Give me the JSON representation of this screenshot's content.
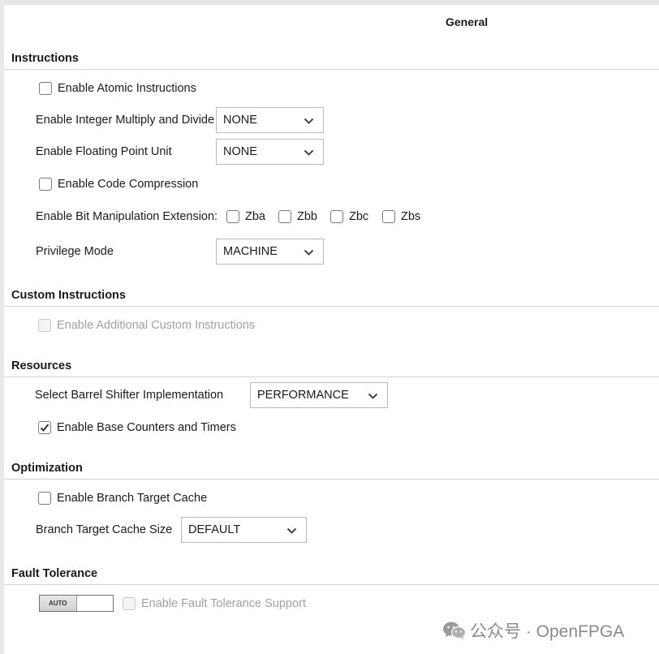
{
  "page": {
    "title": "General"
  },
  "sections": {
    "instructions": {
      "title": "Instructions",
      "atomic": {
        "label": "Enable Atomic Instructions",
        "checked": false
      },
      "mul_div": {
        "label": "Enable Integer Multiply and Divide",
        "value": "NONE"
      },
      "fpu": {
        "label": "Enable Floating Point Unit",
        "value": "NONE"
      },
      "compression": {
        "label": "Enable Code Compression",
        "checked": false
      },
      "bitmanip": {
        "label": "Enable Bit Manipulation Extension:",
        "options": [
          {
            "label": "Zba",
            "checked": false
          },
          {
            "label": "Zbb",
            "checked": false
          },
          {
            "label": "Zbc",
            "checked": false
          },
          {
            "label": "Zbs",
            "checked": false
          }
        ]
      },
      "privilege": {
        "label": "Privilege Mode",
        "value": "MACHINE"
      }
    },
    "custom": {
      "title": "Custom Instructions",
      "additional": {
        "label": "Enable Additional Custom Instructions",
        "checked": false,
        "enabled": false
      }
    },
    "resources": {
      "title": "Resources",
      "barrel": {
        "label": "Select Barrel Shifter Implementation",
        "value": "PERFORMANCE"
      },
      "counters": {
        "label": "Enable Base Counters and Timers",
        "checked": true
      }
    },
    "optimization": {
      "title": "Optimization",
      "btc": {
        "label": "Enable Branch Target Cache",
        "checked": false
      },
      "btc_size": {
        "label": "Branch Target Cache Size",
        "value": "DEFAULT"
      }
    },
    "fault": {
      "title": "Fault Tolerance",
      "toggle_label": "AUTO",
      "support": {
        "label": "Enable Fault Tolerance Support",
        "checked": false,
        "enabled": false
      }
    }
  },
  "watermark": {
    "text": "公众号 · OpenFPGA",
    "icon": "wechat-icon"
  },
  "icons": {
    "dropdown": "chevron-down-icon",
    "check": "checkmark-icon"
  },
  "colors": {
    "rule": "#d4d4d4",
    "disabled_text": "#a0a0a0",
    "border": "#b9b9b9"
  }
}
